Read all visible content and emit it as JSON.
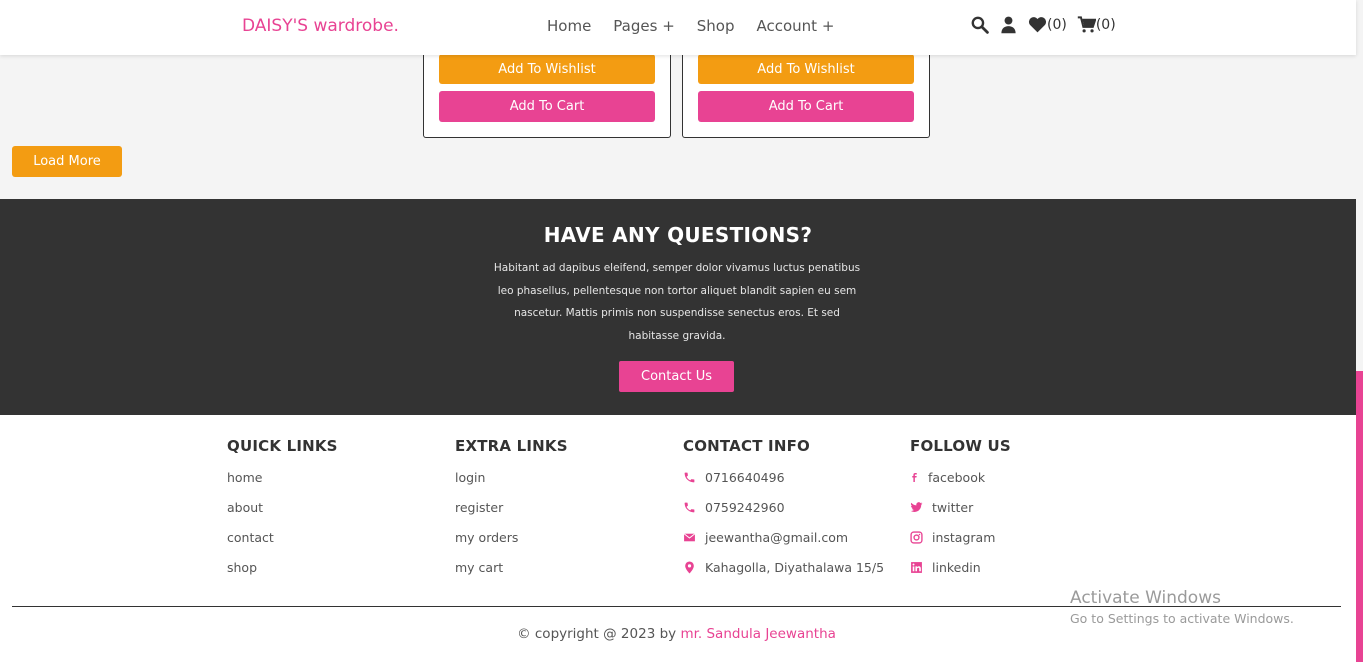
{
  "header": {
    "logo": "DAISY'S wardrobe.",
    "nav": [
      "Home",
      "Pages +",
      "Shop",
      "Account +"
    ],
    "wishlist_count": "(0)",
    "cart_count": "(0)"
  },
  "products": [
    {
      "wishlist_label": "Add To Wishlist",
      "cart_label": "Add To Cart"
    },
    {
      "wishlist_label": "Add To Wishlist",
      "cart_label": "Add To Cart"
    }
  ],
  "load_more_label": "Load More",
  "questions": {
    "title": "HAVE ANY QUESTIONS?",
    "text": "Habitant ad dapibus eleifend, semper dolor vivamus luctus penatibus leo phasellus, pellentesque non tortor aliquet blandit sapien eu sem nascetur. Mattis primis non suspendisse senectus eros. Et sed habitasse gravida.",
    "button_label": "Contact Us"
  },
  "footer": {
    "quick_links": {
      "title": "QUICK LINKS",
      "items": [
        "home",
        "about",
        "contact",
        "shop"
      ]
    },
    "extra_links": {
      "title": "EXTRA LINKS",
      "items": [
        "login",
        "register",
        "my orders",
        "my cart"
      ]
    },
    "contact_info": {
      "title": "CONTACT INFO",
      "items": [
        "0716640496",
        "0759242960",
        "jeewantha@gmail.com",
        "Kahagolla, Diyathalawa 15/5"
      ]
    },
    "follow_us": {
      "title": "FOLLOW US",
      "items": [
        "facebook",
        "twitter",
        "instagram",
        "linkedin"
      ]
    },
    "copyright_prefix": "© copyright @ 2023 by",
    "copyright_author": "mr. Sandula Jeewantha"
  },
  "watermark": {
    "line1": "Activate Windows",
    "line2": "Go to Settings to activate Windows."
  },
  "colors": {
    "accent": "#e84393",
    "orange": "#f39c12",
    "dark": "#333333"
  }
}
